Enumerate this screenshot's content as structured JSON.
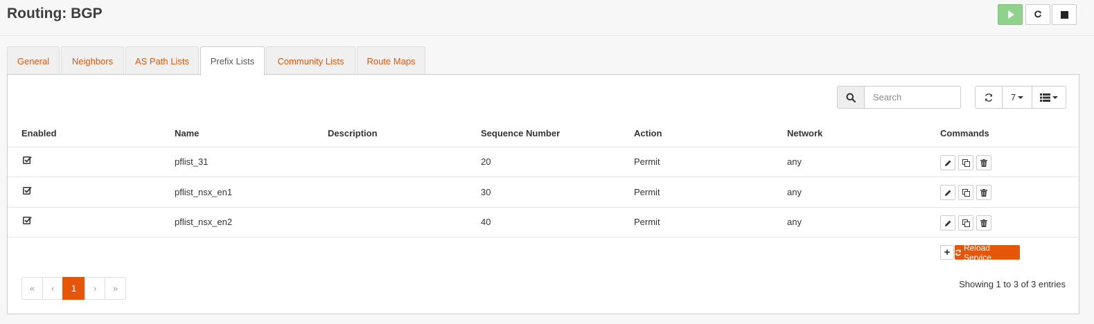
{
  "page": {
    "title": "Routing: BGP"
  },
  "tabs": [
    {
      "label": "General"
    },
    {
      "label": "Neighbors"
    },
    {
      "label": "AS Path Lists"
    },
    {
      "label": "Prefix Lists"
    },
    {
      "label": "Community Lists"
    },
    {
      "label": "Route Maps"
    }
  ],
  "active_tab": "Prefix Lists",
  "search": {
    "placeholder": "Search",
    "value": ""
  },
  "rows_per_page": "7",
  "table": {
    "columns": [
      "Enabled",
      "Name",
      "Description",
      "Sequence Number",
      "Action",
      "Network",
      "Commands"
    ],
    "rows": [
      {
        "enabled": true,
        "name": "pflist_31",
        "description": "",
        "sequence": "20",
        "action": "Permit",
        "network": "any"
      },
      {
        "enabled": true,
        "name": "pflist_nsx_en1",
        "description": "",
        "sequence": "30",
        "action": "Permit",
        "network": "any"
      },
      {
        "enabled": true,
        "name": "pflist_nsx_en2",
        "description": "",
        "sequence": "40",
        "action": "Permit",
        "network": "any"
      }
    ]
  },
  "footer": {
    "add_label": "+",
    "reload_label": "Reload Service"
  },
  "pagination": {
    "first": "«",
    "prev": "‹",
    "current": "1",
    "next": "›",
    "last": "»"
  },
  "entries_info": "Showing 1 to 3 of 3 entries",
  "colors": {
    "accent": "#e5560b",
    "play_button": "#8fd18d"
  },
  "icons": {
    "play": "play-icon",
    "reload": "reload-icon",
    "stop": "stop-icon",
    "search": "search-icon",
    "refresh": "refresh-icon",
    "columns": "list-icon",
    "checkbox": "checkbox-checked-icon",
    "edit": "pencil-icon",
    "copy": "copy-icon",
    "delete": "trash-icon"
  }
}
